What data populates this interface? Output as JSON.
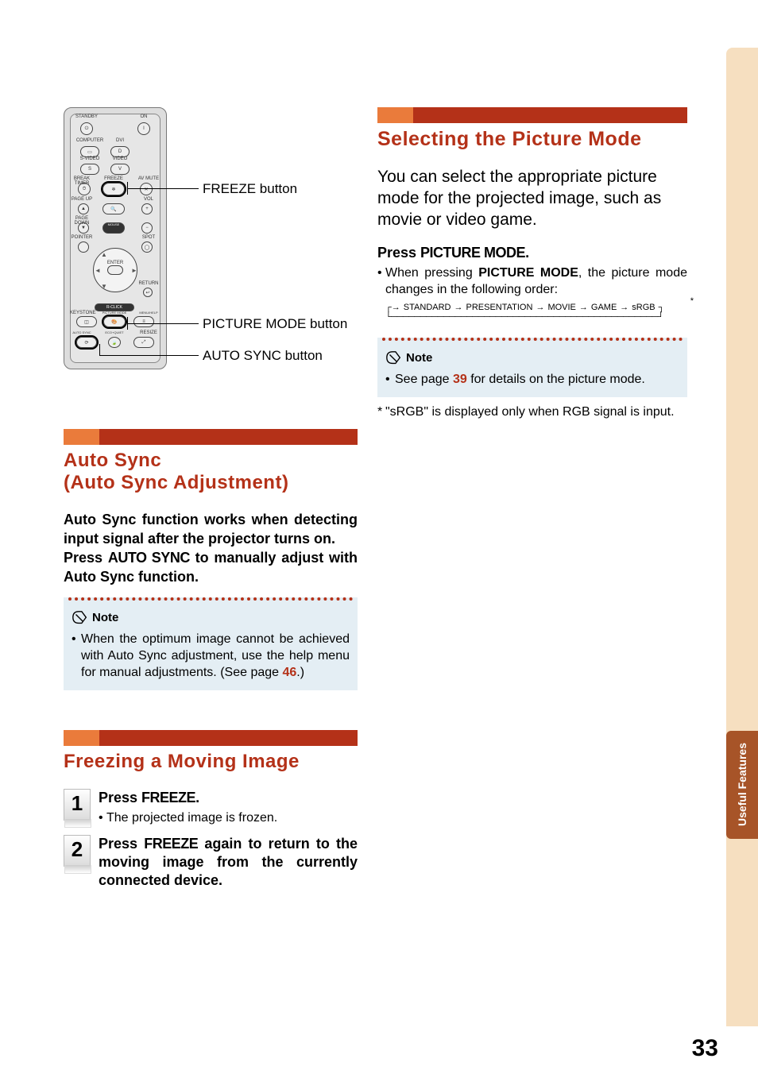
{
  "side_tab": {
    "label": "Useful\nFeatures"
  },
  "page_number": "33",
  "remote": {
    "buttons": {
      "standby": "STANDBY",
      "on": "ON",
      "computer": "COMPUTER",
      "dvi": "DVI",
      "svideo": "S-VIDEO",
      "video": "VIDEO",
      "break_timer": "BREAK TIMER",
      "freeze": "FREEZE",
      "av_mute": "AV MUTE",
      "page_up": "PAGE UP",
      "vol_up": "VOL",
      "page_down": "PAGE DOWN",
      "vol_down": "VOL",
      "mouse": "MOUSE",
      "pointer": "POINTER",
      "spot": "SPOT",
      "enter": "ENTER",
      "return": "RETURN",
      "rclick": "R-CLICK",
      "keystone": "KEYSTONE",
      "picture_mode": "PICTURE MODE",
      "menu_help": "MENU/HELP",
      "auto_sync": "AUTO SYNC",
      "eco_quiet": "ECO+QUIET",
      "resize": "RESIZE"
    },
    "callouts": {
      "freeze": "FREEZE button",
      "picture_mode": "PICTURE MODE button",
      "auto_sync": "AUTO SYNC button"
    }
  },
  "left_sections": {
    "auto_sync": {
      "title": "Auto Sync\n(Auto Sync Adjustment)",
      "desc_line1": "Auto Sync function works when detecting input signal after the projector turns on.",
      "press_prefix": "Press ",
      "press_kw": "AUTO SYNC",
      "press_suffix": " to manually adjust with Auto Sync function.",
      "note_label": "Note",
      "note_text_pre": "When the optimum image cannot be achieved with Auto Sync adjustment, use the help menu for manual adjustments. (See page ",
      "note_page": "46",
      "note_text_post": ".)"
    },
    "freezing": {
      "title": "Freezing a Moving Image",
      "steps": [
        {
          "num": "1",
          "press_prefix": "Press ",
          "press_kw": "FREEZE",
          "press_suffix": ".",
          "sub": "The projected image is frozen."
        },
        {
          "num": "2",
          "press_prefix": "Press ",
          "press_kw": "FREEZE",
          "press_suffix": " again to return to the moving image from the currently connected device.",
          "sub": ""
        }
      ]
    }
  },
  "right_sections": {
    "picture_mode": {
      "title": "Selecting the Picture Mode",
      "body": "You can select the appropriate picture mode for the projected image, such as movie or video game.",
      "press_prefix": "Press ",
      "press_kw": "PICTURE MODE",
      "press_suffix": ".",
      "bullet_pre": "When pressing ",
      "bullet_kw": "PICTURE MODE",
      "bullet_post": ", the picture mode changes in the following order:",
      "sequence": [
        "STANDARD",
        "PRESENTATION",
        "MOVIE",
        "GAME",
        "sRGB"
      ],
      "note_label": "Note",
      "note_text_pre": "See page ",
      "note_page": "39",
      "note_text_post": " for details on the picture mode.",
      "footnote": "\"sRGB\" is displayed only when RGB signal is input."
    }
  }
}
